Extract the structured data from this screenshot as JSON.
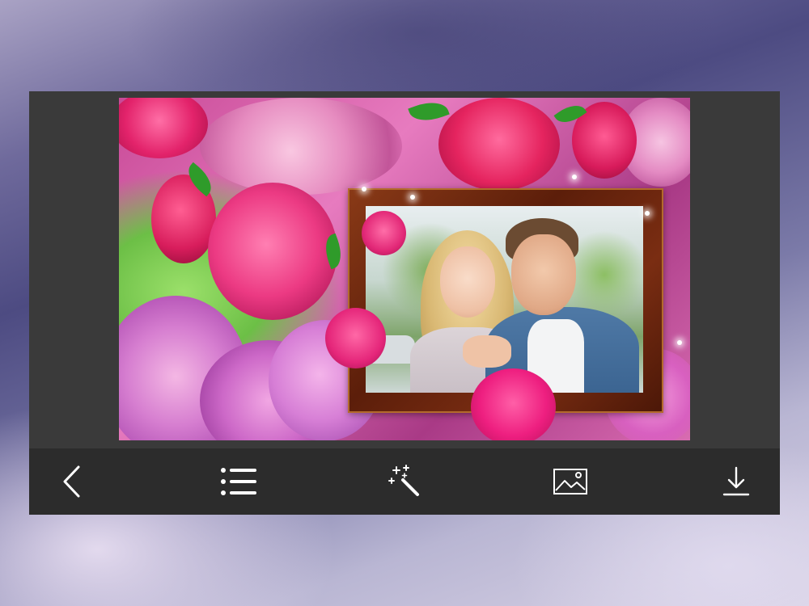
{
  "toolbar": {
    "buttons": [
      {
        "name": "back",
        "icon": "chevron-left-icon",
        "label": ""
      },
      {
        "name": "menu",
        "icon": "list-icon",
        "label": ""
      },
      {
        "name": "effects",
        "icon": "magic-wand-icon",
        "label": ""
      },
      {
        "name": "gallery",
        "icon": "image-icon",
        "label": ""
      },
      {
        "name": "download",
        "icon": "download-icon",
        "label": ""
      }
    ]
  },
  "colors": {
    "panel_bg": "#3a3a3a",
    "toolbar_bg": "#2c2c2c",
    "icon_color": "#ffffff",
    "frame_wood": "#6b2a10"
  }
}
